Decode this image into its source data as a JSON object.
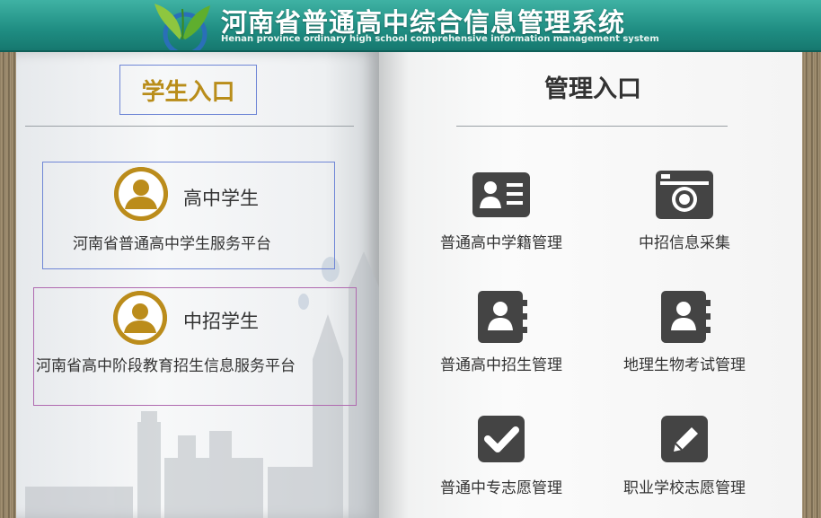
{
  "header": {
    "title_cn": "河南省普通高中综合信息管理系统",
    "title_en": "Henan province ordinary high school comprehensive information management system"
  },
  "student_section": {
    "title": "学生入口",
    "entries": [
      {
        "name": "高中学生",
        "desc": "河南省普通高中学生服务平台",
        "icon": "user-circle-icon"
      },
      {
        "name": "中招学生",
        "desc": "河南省高中阶段教育招生信息服务平台",
        "icon": "user-circle-icon"
      }
    ]
  },
  "admin_section": {
    "title": "管理入口",
    "tiles": [
      {
        "label": "普通高中学籍管理",
        "icon": "id-card-icon"
      },
      {
        "label": "中招信息采集",
        "icon": "camera-icon"
      },
      {
        "label": "普通高中招生管理",
        "icon": "contact-book-icon"
      },
      {
        "label": "地理生物考试管理",
        "icon": "contact-book-icon"
      },
      {
        "label": "普通中专志愿管理",
        "icon": "checkbox-icon"
      },
      {
        "label": "职业学校志愿管理",
        "icon": "edit-icon"
      }
    ]
  },
  "colors": {
    "header": "#1f8d82",
    "accent_gold": "#bb8c1b",
    "icon_dark": "#444444"
  }
}
